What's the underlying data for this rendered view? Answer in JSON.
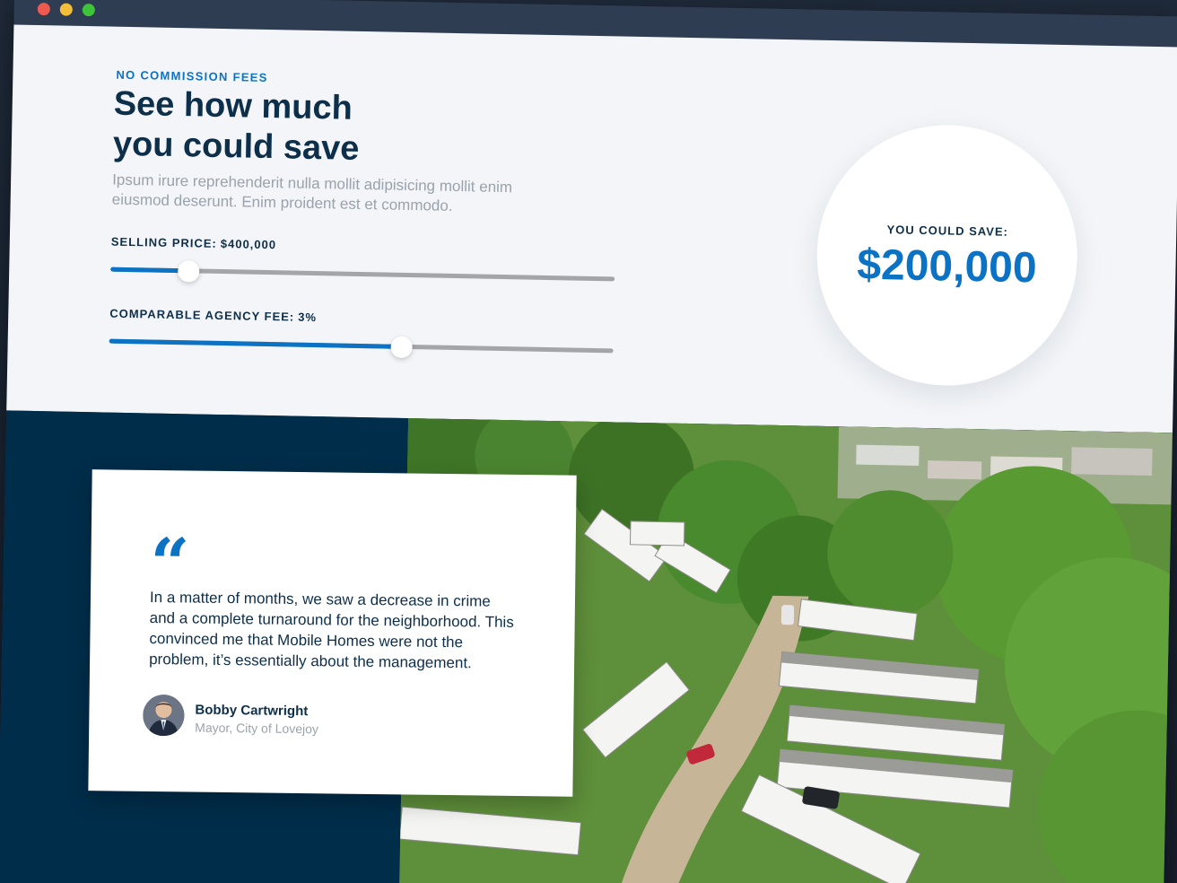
{
  "calculator": {
    "eyebrow": "NO COMMISSION FEES",
    "headline": "See how much you could save",
    "lede": "Ipsum irure reprehenderit nulla mollit adipisicing mollit enim eiusmod deserunt. Enim proident est et commodo.",
    "selling_price": {
      "label": "SELLING PRICE:",
      "value": "$400,000",
      "level": 0.155
    },
    "agency_fee": {
      "label": "COMPARABLE AGENCY FEE:",
      "value": "3%",
      "level": 0.58
    },
    "result": {
      "label": "YOU COULD SAVE:",
      "value": "$200,000"
    }
  },
  "testimonial": {
    "quote_mark": "“",
    "quote": "In a matter of months, we saw a decrease in crime and a complete turnaround for the neighborhood. This convinced me that Mobile Homes were not the problem, it’s essentially about the management.",
    "author_name": "Bobby Cartwright",
    "author_role": "Mayor, City of Lovejoy"
  },
  "colors": {
    "accent": "#0c73c4",
    "navy": "#0d2f4a",
    "dark_band": "#002d4a",
    "muted": "#9aa2ab"
  }
}
